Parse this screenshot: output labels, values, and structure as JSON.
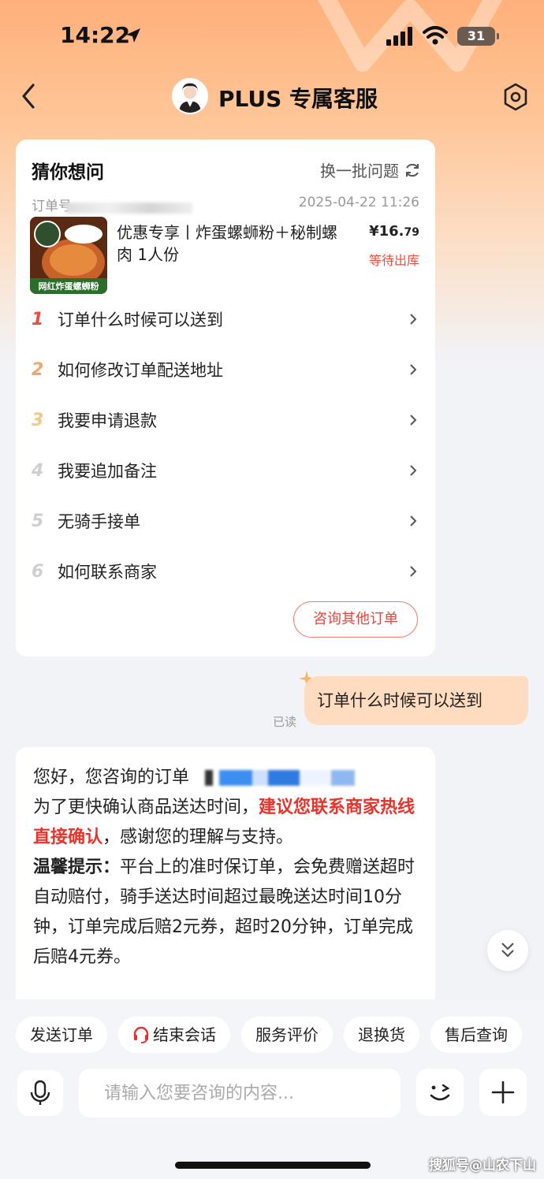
{
  "status_bar": {
    "time": "14:22",
    "battery": "31",
    "icons": [
      "location-arrow-icon",
      "signal-icon",
      "wifi-icon",
      "battery-icon"
    ]
  },
  "nav": {
    "title": "PLUS 专属客服",
    "icons": [
      "back-icon",
      "avatar",
      "settings-icon"
    ]
  },
  "card": {
    "title": "猜你想问",
    "refresh_label": "换一批问题",
    "order_label": "订单号",
    "order_time": "2025-04-22 11:26",
    "product_image_text": "网红炸蛋螺蛳粉",
    "product_name": "优惠专享丨炸蛋螺蛳粉＋秘制螺肉 1人份",
    "price_main": "¥16.",
    "price_cents": "79",
    "order_status": "等待出库",
    "questions": [
      {
        "num": "1",
        "text": "订单什么时候可以送到",
        "color": "#ee4b3f"
      },
      {
        "num": "2",
        "text": "如何修改订单配送地址",
        "color": "#f4a56a"
      },
      {
        "num": "3",
        "text": "我要申请退款",
        "color": "#f3c98a"
      },
      {
        "num": "4",
        "text": "我要追加备注",
        "color": "#cfcfcf"
      },
      {
        "num": "5",
        "text": "无骑手接单",
        "color": "#cfcfcf"
      },
      {
        "num": "6",
        "text": "如何联系商家",
        "color": "#cfcfcf"
      }
    ],
    "other_orders_label": "咨询其他订单"
  },
  "user_message": {
    "text": "订单什么时候可以送到",
    "read_status": "已读"
  },
  "reply": {
    "line1": "您好，您咨询的订单",
    "part_normal_1": "为了更快确认商品送达时间，",
    "part_red": "建议您联系商家热线直接确认",
    "part_normal_2": "，感谢您的理解与支持。",
    "tip_label": "温馨提示：",
    "tip_text": "平台上的准时保订单，会免费赠送超时自动赔付，骑手送达时间超过最晚送达时间10分钟，订单完成后赔2元券，超时20分钟，订单完成后赔4元券。"
  },
  "quick_actions": [
    {
      "label": "发送订单",
      "icon": ""
    },
    {
      "label": "结束会话",
      "icon": "headset-icon"
    },
    {
      "label": "服务评价",
      "icon": ""
    },
    {
      "label": "退换货",
      "icon": ""
    },
    {
      "label": "售后查询",
      "icon": ""
    }
  ],
  "input": {
    "placeholder": "请输入您要咨询的内容..."
  },
  "watermark": "搜狐号@山农下山",
  "colors": {
    "accent_red": "#e8322a",
    "user_bubble": "#ffdcbf",
    "header_orange": "#ffb07a"
  }
}
